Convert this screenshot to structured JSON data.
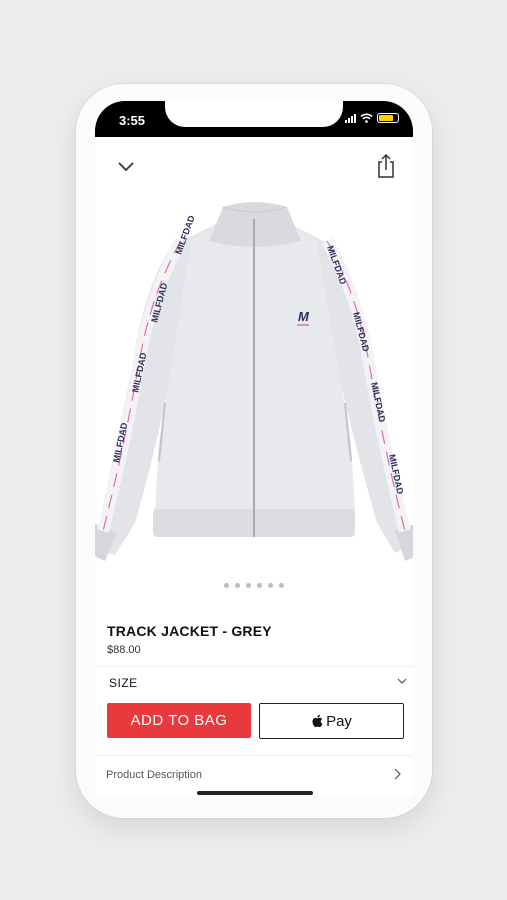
{
  "status_bar": {
    "time": "3:55"
  },
  "product": {
    "title": "TRACK JACKET - GREY",
    "price": "$88.00",
    "sleeve_text": "MILFDAD",
    "chest_logo": "M",
    "image_dots": 6
  },
  "size": {
    "label": "SIZE"
  },
  "actions": {
    "add_to_bag": "ADD TO BAG",
    "apple_pay": "Pay"
  },
  "description": {
    "label": "Product Description"
  },
  "icons": [
    "chevron-down-icon",
    "share-icon",
    "apple-icon",
    "chevron-right-icon"
  ],
  "colors": {
    "accent": "#e8393c",
    "jacket": "#e7e8ec"
  }
}
